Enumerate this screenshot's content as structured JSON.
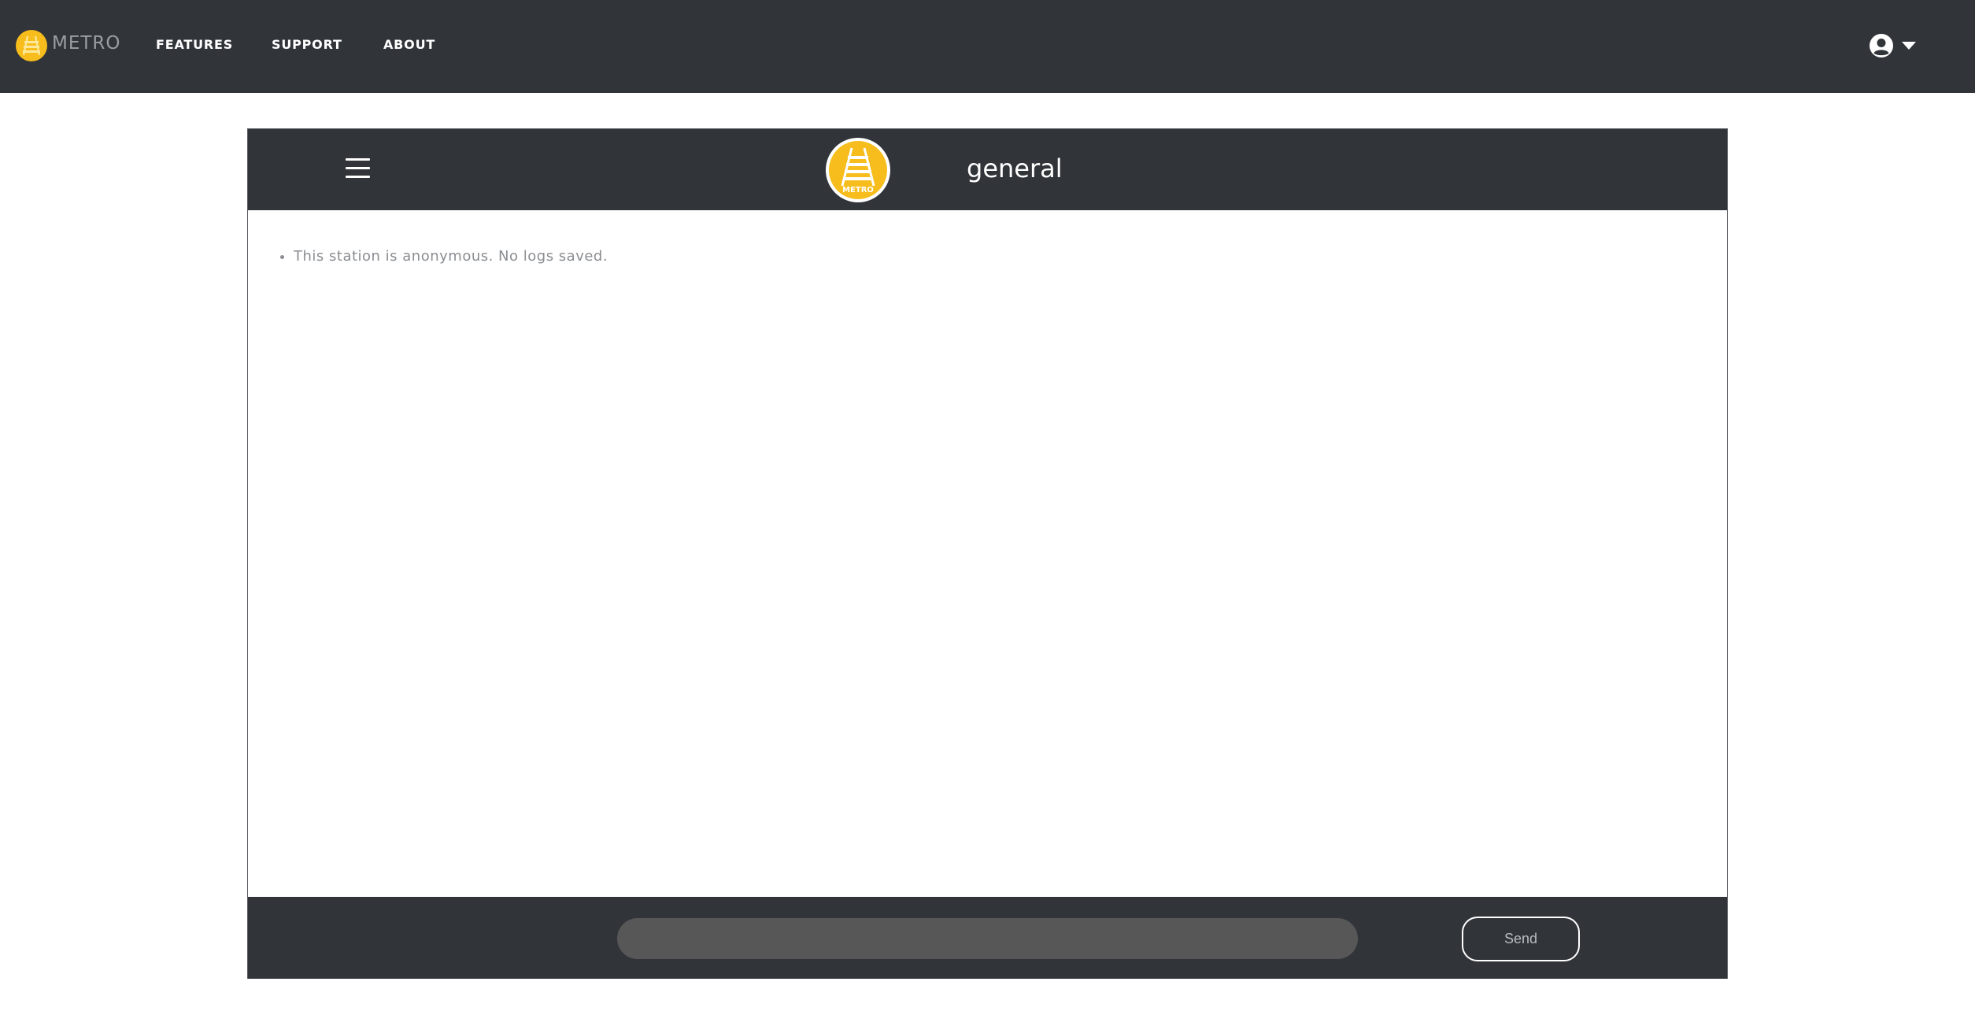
{
  "navbar": {
    "brand": "METRO",
    "links": [
      "FEATURES",
      "SUPPORT",
      "ABOUT"
    ],
    "user_icon": "user-circle-icon",
    "dropdown_icon": "caret-down-icon"
  },
  "chat": {
    "menu_icon": "hamburger-menu-icon",
    "station_logo": "metro-track-logo",
    "station_logo_text": "METRO",
    "channel": "general",
    "messages": [
      "This station is anonymous. No logs saved."
    ],
    "input_value": "",
    "send_label": "Send"
  },
  "colors": {
    "bar_background": "#31353a",
    "accent_yellow": "#f7bd1c",
    "input_background": "#575757",
    "message_text": "#8a8d91"
  }
}
